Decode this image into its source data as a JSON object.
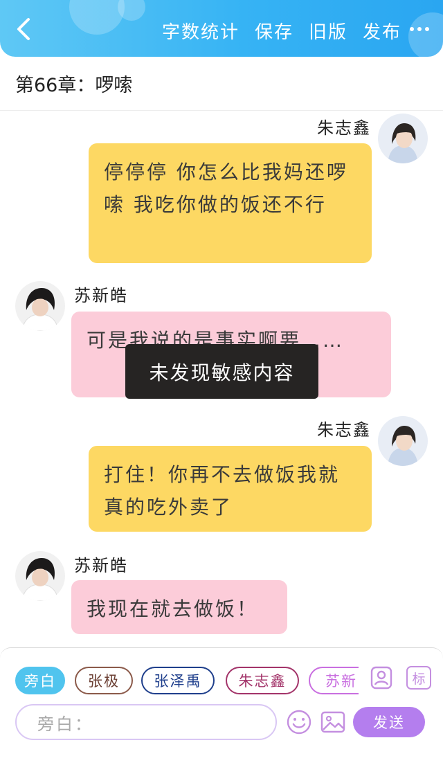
{
  "header": {
    "actions": [
      "字数统计",
      "保存",
      "旧版",
      "发布"
    ]
  },
  "chapter": {
    "title": "第66章：啰嗦"
  },
  "messages": [
    {
      "speaker": "朱志鑫",
      "side": "right",
      "text": "停停停 你怎么比我妈还啰嗦 我吃你做的饭还不行"
    },
    {
      "speaker": "苏新皓",
      "side": "left",
      "text": "可是我说的是事实啊要……"
    },
    {
      "speaker": "朱志鑫",
      "side": "right",
      "text": "打住！你再不去做饭我就真的吃外卖了"
    },
    {
      "speaker": "苏新皓",
      "side": "left",
      "text": "我现在就去做饭！"
    }
  ],
  "toast": {
    "text": "未发现敏感内容"
  },
  "composer": {
    "characters": [
      "旁白",
      "张极",
      "张泽禹",
      "朱志鑫",
      "苏新"
    ],
    "active_character": "旁白",
    "role_icon_label": "标",
    "input_placeholder": "旁白：",
    "send_label": "发送"
  },
  "colors": {
    "header": "#36b3f4",
    "right_bubble": "#fdd863",
    "left_bubble": "#fcccd9",
    "send_button": "#b47eee",
    "chip_zhangji": "#8b5a4a",
    "chip_zhangzeyu": "#1f3f8c",
    "chip_zhuzhixin": "#a3346a",
    "chip_suxin": "#c96fe0"
  }
}
